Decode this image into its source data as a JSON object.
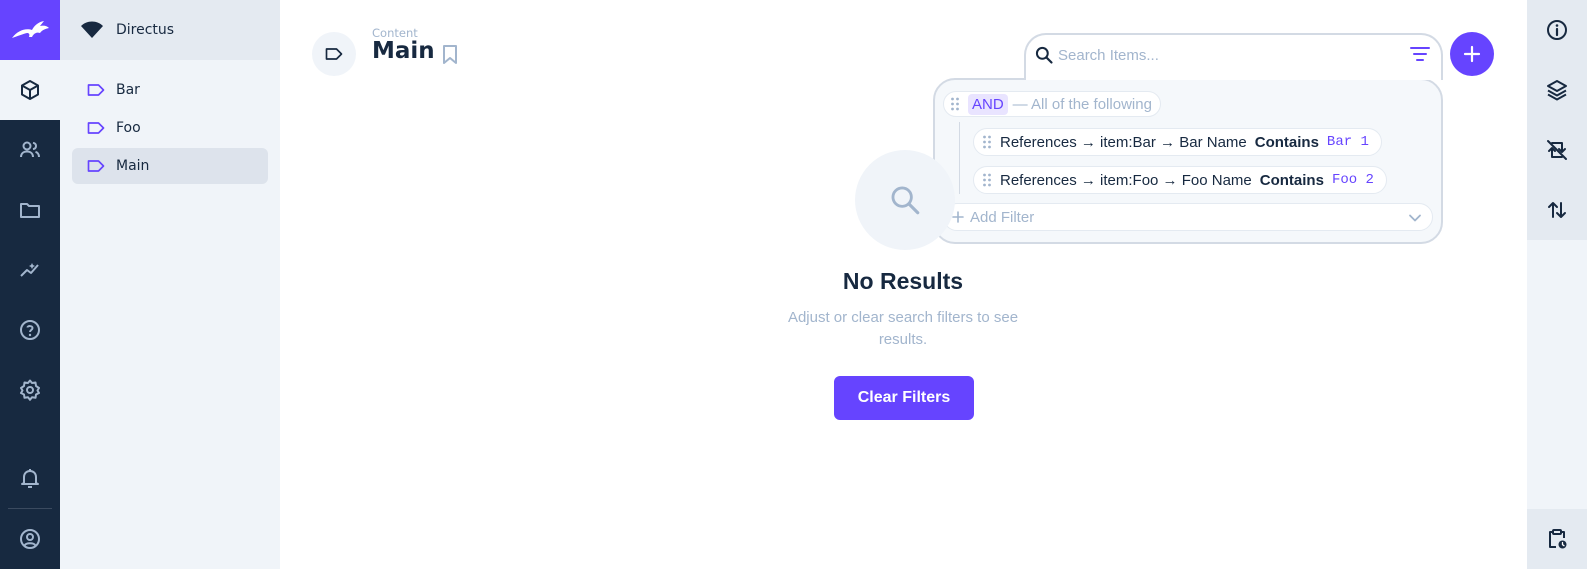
{
  "project": {
    "name": "Directus"
  },
  "navigation": {
    "items": [
      {
        "label": "Bar",
        "active": false
      },
      {
        "label": "Foo",
        "active": false
      },
      {
        "label": "Main",
        "active": true
      }
    ]
  },
  "module_bar": {
    "items": [
      "content-icon",
      "users-icon",
      "folder-icon",
      "insights-icon",
      "help-icon",
      "settings-icon",
      "notifications-icon",
      "user-icon"
    ]
  },
  "header": {
    "breadcrumb": "Content",
    "title": "Main"
  },
  "search": {
    "placeholder": "Search Items..."
  },
  "filter": {
    "group_operator": "AND",
    "group_label": "— All of the following",
    "rules": [
      {
        "field": "References → item:Bar → Bar Name",
        "operator": "Contains",
        "value": "Bar 1"
      },
      {
        "field": "References → item:Foo → Foo Name",
        "operator": "Contains",
        "value": "Foo 2"
      }
    ],
    "add_label": "Add Filter"
  },
  "empty_state": {
    "title": "No Results",
    "description": "Adjust or clear search filters to see results.",
    "button_label": "Clear Filters"
  },
  "colors": {
    "accent": "#6644ff",
    "module_bar": "#172940",
    "nav_bg": "#f0f4f9",
    "subdued": "#a2b5cd"
  }
}
